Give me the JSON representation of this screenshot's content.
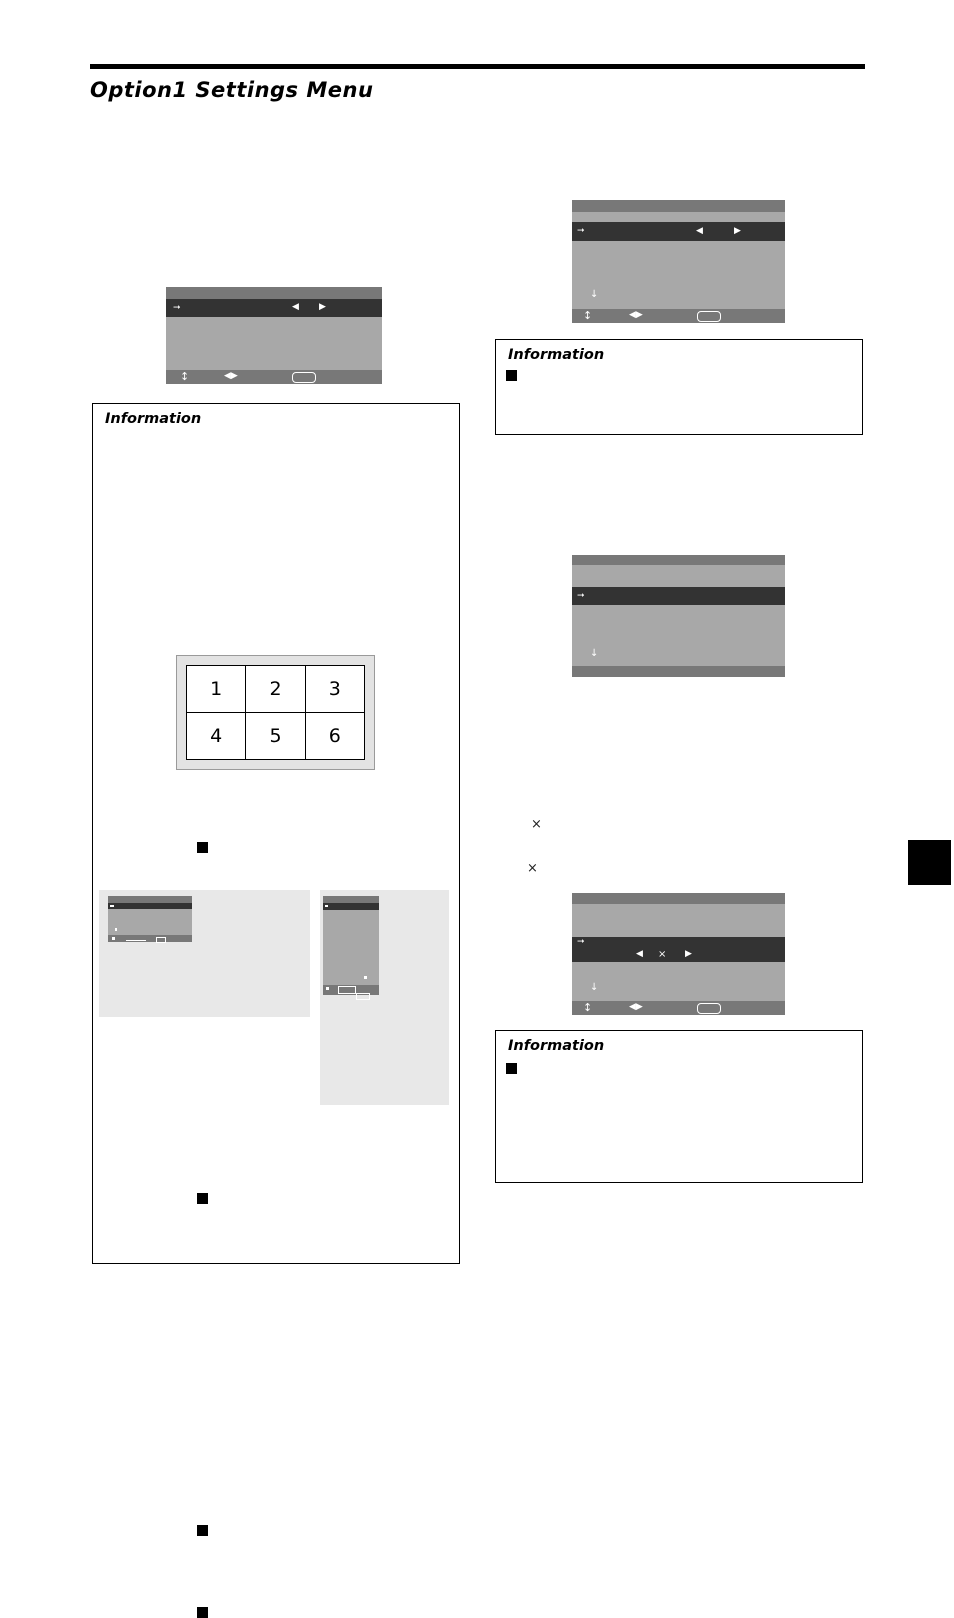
{
  "document": {
    "title": "Option1 Settings Menu",
    "page_tab_label": ""
  },
  "info_panels": [
    {
      "id": "info-left",
      "title": "Information",
      "bullets": [
        "",
        "",
        "",
        "",
        ""
      ]
    },
    {
      "id": "info-right-top",
      "title": "Information",
      "bullets": [
        ""
      ]
    },
    {
      "id": "info-right-bottom",
      "title": "Information",
      "bullets": [
        ""
      ]
    }
  ],
  "osd_menus": [
    {
      "id": "osd-left-top",
      "rows": [
        {
          "type": "title",
          "text": ""
        },
        {
          "type": "selected",
          "text": "",
          "left_arrow": "◀",
          "right_arrow": "▶"
        },
        {
          "type": "body",
          "text": ""
        }
      ],
      "footer": {
        "up_down_icon": "↕",
        "left_right_icon": "◀▶",
        "button_icon": "button-box"
      }
    },
    {
      "id": "osd-right-top",
      "rows": [
        {
          "type": "title",
          "text": ""
        },
        {
          "type": "plain",
          "text": ""
        },
        {
          "type": "selected",
          "text": "",
          "left_arrow": "◀",
          "right_arrow": "▶"
        },
        {
          "type": "body",
          "text": "",
          "scroll_icon": "↓"
        }
      ],
      "footer": {
        "up_down_icon": "↕",
        "left_right_icon": "◀▶",
        "button_icon": "button-box"
      }
    },
    {
      "id": "osd-right-middle",
      "rows": [
        {
          "type": "title",
          "text": ""
        },
        {
          "type": "plain",
          "text": ""
        },
        {
          "type": "selected",
          "text": ""
        },
        {
          "type": "body",
          "text": "",
          "scroll_icon": "↓"
        }
      ],
      "footer": null
    },
    {
      "id": "osd-right-bottom",
      "rows": [
        {
          "type": "title",
          "text": ""
        },
        {
          "type": "plain",
          "text": ""
        },
        {
          "type": "selected",
          "text": "",
          "left_arrow": "◀",
          "multiply": "×",
          "right_arrow": "▶"
        },
        {
          "type": "body",
          "text": "",
          "scroll_icon": "↓"
        }
      ],
      "footer": {
        "up_down_icon": "↕",
        "left_right_icon": "◀▶",
        "button_icon": "button-box"
      }
    }
  ],
  "split_grid": {
    "caption": "",
    "rows": 2,
    "columns": 3,
    "cells": [
      "1",
      "2",
      "3",
      "4",
      "5",
      "6"
    ]
  },
  "illustrations": [
    {
      "id": "illustration-left",
      "caption": ""
    },
    {
      "id": "illustration-right",
      "caption": ""
    }
  ],
  "inline_marks": [
    {
      "id": "multiply-mark-1",
      "glyph": "×"
    },
    {
      "id": "multiply-mark-2",
      "glyph": "×"
    }
  ],
  "colors": {
    "osd_title_bar": "#787878",
    "osd_body": "#a8a8a8",
    "osd_selected_row": "#333333",
    "osd_glyph": "#ffffff",
    "illustration_bg": "#e8e8e8",
    "ink": "#000000"
  }
}
